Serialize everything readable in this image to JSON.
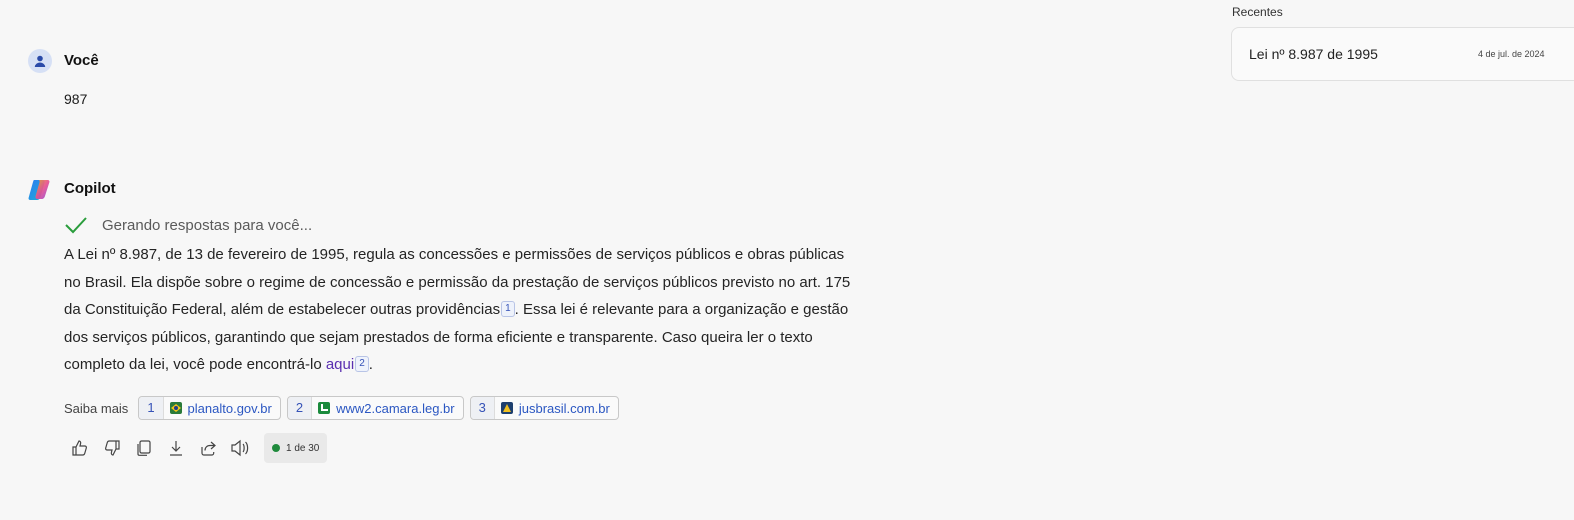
{
  "user": {
    "name": "Você",
    "message": "987"
  },
  "copilot": {
    "name": "Copilot",
    "status": "Gerando respostas para você...",
    "answer": {
      "p1": "A Lei nº 8.987, de 13 de fevereiro de 1995, regula as concessões e permissões de serviços públicos e obras públicas no Brasil. Ela dispõe sobre o regime de concessão e permissão da prestação de serviços públicos previsto no art. 175 da Constituição Federal, além de estabelecer outras providências",
      "cite1": "1",
      "p2": ". Essa lei é relevante para a organização e gestão dos serviços públicos, garantindo que sejam prestados de forma eficiente e transparente. Caso queira ler o texto completo da lei, você pode encontrá-lo ",
      "link": "aqui",
      "cite2": "2",
      "p3": "."
    },
    "learn_more": {
      "label": "Saiba mais",
      "sources": [
        {
          "num": "1",
          "name": "planalto.gov.br"
        },
        {
          "num": "2",
          "name": "www2.camara.leg.br"
        },
        {
          "num": "3",
          "name": "jusbrasil.com.br"
        }
      ]
    },
    "pager": "1 de 30"
  },
  "recent": {
    "label": "Recentes",
    "items": [
      {
        "title": "Lei nº 8.987 de 1995",
        "date": "4 de jul. de 2024"
      }
    ]
  }
}
